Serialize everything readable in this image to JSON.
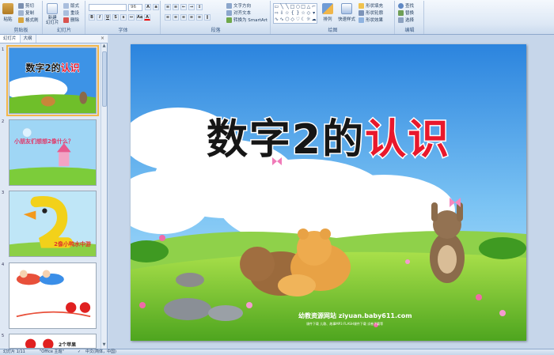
{
  "ribbon": {
    "clipboard": {
      "label": "剪贴板",
      "paste": "粘贴",
      "cut": "剪切",
      "copy": "复制",
      "format_painter": "格式刷"
    },
    "slides": {
      "label": "幻灯片",
      "new_slide": "新建\n幻灯片",
      "layout": "版式",
      "reset": "重设",
      "delete": "删除"
    },
    "font": {
      "label": "字体",
      "font_size": "96"
    },
    "paragraph": {
      "label": "段落",
      "text_direction": "文字方向",
      "align_text": "对齐文本",
      "smartart": "转换为 SmartArt"
    },
    "drawing": {
      "label": "绘图",
      "arrange": "排列",
      "quick_styles": "快速样式",
      "shape_fill": "形状填充",
      "shape_outline": "形状轮廓",
      "shape_effects": "形状效果"
    },
    "editing": {
      "label": "编辑",
      "find": "查找",
      "replace": "替换",
      "select": "选择"
    }
  },
  "panel": {
    "tabs": [
      "幻灯片",
      "大纲"
    ],
    "close": "×",
    "thumbnails": [
      {
        "num": "1",
        "title_black": "数字2的",
        "title_red": "认识"
      },
      {
        "num": "2",
        "question": "小朋友们想想2像什么？"
      },
      {
        "num": "3",
        "caption": "2像小鸭水中游"
      },
      {
        "num": "4"
      },
      {
        "num": "5",
        "caption": "2个苹果"
      }
    ]
  },
  "slide": {
    "title_black": "数字2的",
    "title_red": "认识",
    "site": "幼教资源网站  ziyuan.baby611.com",
    "site_sub": "课件下载  儿歌、故事MP3  FLASH课件下载  试卷下载等"
  },
  "status": {
    "slide_count": "幻灯片 1/11",
    "theme": "\"Office 主题\"",
    "language": "中文(简体，中国)"
  },
  "colors": {
    "sky_top": "#2e86e0",
    "grass": "#6fbf2a",
    "title_red": "#e8182c",
    "ribbon_bg": "#dde8f5"
  }
}
